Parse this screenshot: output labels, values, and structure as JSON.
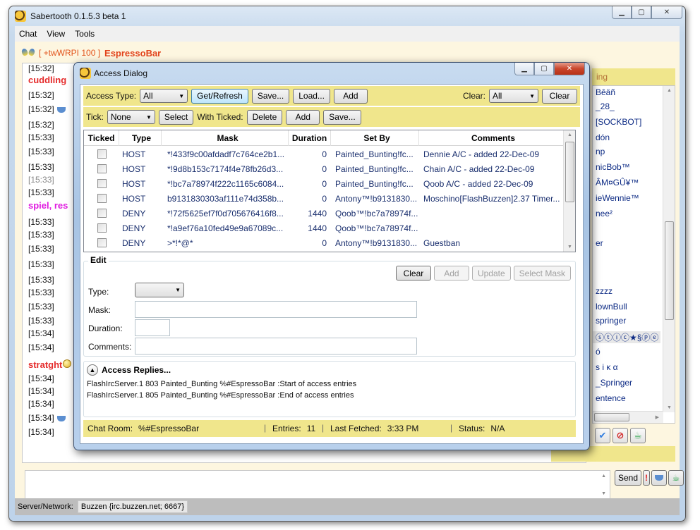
{
  "main_window": {
    "title": "Sabertooth 0.1.5.3 beta 1",
    "caption_buttons": [
      "minimize",
      "maximize",
      "close"
    ],
    "menu": [
      "Chat",
      "View",
      "Tools"
    ],
    "channel": {
      "modes": "[ +twWRPI  100 ]",
      "name": "EspressoBar"
    },
    "chat_lines": [
      {
        "text": "[15:32]",
        "style": "normal"
      },
      {
        "text": "cuddling",
        "style": "nick-red"
      },
      {
        "text": "[15:32]",
        "style": "normal"
      },
      {
        "text": "[15:32]",
        "style": "normal",
        "icon": "coffee-cup"
      },
      {
        "text": "[15:32]",
        "style": "normal"
      },
      {
        "text": "[15:33]",
        "style": "normal"
      },
      {
        "text": "[15:33]",
        "style": "normal"
      },
      {
        "text": "[15:33]",
        "style": "normal"
      },
      {
        "text": "[15:33]",
        "style": "gray"
      },
      {
        "text": "[15:33]",
        "style": "normal"
      },
      {
        "text": "spiel, res",
        "style": "nick-magenta"
      },
      {
        "text": "[15:33]",
        "style": "normal"
      },
      {
        "text": "[15:33]",
        "style": "normal"
      },
      {
        "text": "[15:33]",
        "style": "normal"
      },
      {
        "text": "[15:33]",
        "style": "normal"
      },
      {
        "text": "[15:33]",
        "style": "normal"
      },
      {
        "text": "[15:33]",
        "style": "normal"
      },
      {
        "text": "[15:33]",
        "style": "normal"
      },
      {
        "text": "[15:33]",
        "style": "normal"
      },
      {
        "text": "[15:34]",
        "style": "normal"
      },
      {
        "text": "[15:34]",
        "style": "normal"
      },
      {
        "text": "stratght",
        "style": "nick-red",
        "icon": "smiley"
      },
      {
        "text": "[15:34]",
        "style": "normal"
      },
      {
        "text": "[15:34]",
        "style": "normal"
      },
      {
        "text": "[15:34]",
        "style": "normal"
      },
      {
        "text": "[15:34]",
        "style": "normal",
        "icon": "coffee-cup"
      },
      {
        "text": "[15:34]",
        "style": "normal"
      }
    ],
    "userlist": {
      "header": "ing",
      "users": [
        "Bêäñ",
        "_28_",
        "[SOCKBOT]",
        "dón",
        "np",
        "nicBob™",
        "ÂM¤GÛ¥™",
        "ieWennie™",
        "nee²",
        "",
        "er",
        "",
        "",
        "zzzz",
        "lownBull",
        "springer",
        "ⓢⓣⓘⓒ★§ⓟⓔ",
        "ó",
        "s i κ α",
        "_Springer",
        "entence"
      ],
      "selected_index": 16
    },
    "user_actions": [
      "check-icon",
      "ban-icon",
      "tea-icon"
    ],
    "input": {
      "value": "",
      "send_label": "Send",
      "alert_label": "!"
    },
    "statusbar": {
      "label": "Server/Network:",
      "server": "Buzzen {irc.buzzen.net; 6667}"
    }
  },
  "dialog": {
    "title": "Access Dialog",
    "toolbar1": {
      "access_type_label": "Access Type:",
      "access_type_value": "All",
      "get_refresh": "Get/Refresh",
      "save": "Save...",
      "load": "Load...",
      "add": "Add",
      "clear_label": "Clear:",
      "clear_value": "All",
      "clear": "Clear"
    },
    "toolbar2": {
      "tick_label": "Tick:",
      "tick_value": "None",
      "select": "Select",
      "with_ticked_label": "With Ticked:",
      "delete": "Delete",
      "add": "Add",
      "save": "Save..."
    },
    "grid": {
      "columns": [
        "Ticked",
        "Type",
        "Mask",
        "Duration",
        "Set By",
        "Comments"
      ],
      "rows": [
        {
          "ticked": false,
          "type": "HOST",
          "mask": "*!433f9c00afdadf7c764ce2b1...",
          "duration": "0",
          "set_by": "Painted_Bunting!fc...",
          "comments": "Dennie A/C - added 22-Dec-09"
        },
        {
          "ticked": false,
          "type": "HOST",
          "mask": "*!9d8b153c7174f4e78fb26d3...",
          "duration": "0",
          "set_by": "Painted_Bunting!fc...",
          "comments": "Chain A/C - added 22-Dec-09"
        },
        {
          "ticked": false,
          "type": "HOST",
          "mask": "*!bc7a78974f222c1165c6084...",
          "duration": "0",
          "set_by": "Painted_Bunting!fc...",
          "comments": "Qoob A/C - added 22-Dec-09"
        },
        {
          "ticked": false,
          "type": "HOST",
          "mask": "b9131830303af111e74d358b...",
          "duration": "0",
          "set_by": "Antony™!b9131830...",
          "comments": "Moschino[FlashBuzzen]2.37 Timer..."
        },
        {
          "ticked": false,
          "type": "DENY",
          "mask": "*!72f5625ef7f0d705676416f8...",
          "duration": "1440",
          "set_by": "Qoob™!bc7a78974f...",
          "comments": ""
        },
        {
          "ticked": false,
          "type": "DENY",
          "mask": "*!a9ef76a10fed49e9a67089c...",
          "duration": "1440",
          "set_by": "Qoob™!bc7a78974f...",
          "comments": ""
        },
        {
          "ticked": false,
          "type": "DENY",
          "mask": ">*!*@*",
          "duration": "0",
          "set_by": "Antony™!b9131830...",
          "comments": " Guestban"
        }
      ]
    },
    "edit": {
      "legend": "Edit",
      "clear": "Clear",
      "add": "Add",
      "update": "Update",
      "select_mask": "Select Mask",
      "type_label": "Type:",
      "type_value": "",
      "mask_label": "Mask:",
      "mask_value": "",
      "duration_label": "Duration:",
      "duration_value": "",
      "comments_label": "Comments:",
      "comments_value": ""
    },
    "replies": {
      "title": "Access Replies...",
      "lines": [
        "FlashIrcServer.1 803 Painted_Bunting %#EspressoBar :Start of access entries",
        "FlashIrcServer.1 805 Painted_Bunting %#EspressoBar :End of access entries"
      ]
    },
    "status": {
      "chat_room_label": "Chat Room:",
      "chat_room": "%#EspressoBar",
      "entries_label": "Entries:",
      "entries": "11",
      "last_fetched_label": "Last Fetched:",
      "last_fetched": "3:33 PM",
      "status_label": "Status:",
      "status": "N/A"
    }
  }
}
